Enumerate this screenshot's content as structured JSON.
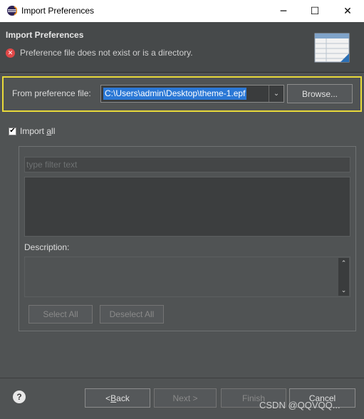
{
  "window": {
    "title": "Import Preferences",
    "minimize_icon": "─",
    "maximize_icon": "☐",
    "close_icon": "✕"
  },
  "header": {
    "title": "Import Preferences",
    "error_message": "Preference file does not exist or is a directory.",
    "error_icon": "✕"
  },
  "file_row": {
    "label": "From preference file:",
    "value": "C:\\Users\\admin\\Desktop\\theme-1.epf",
    "dropdown_icon": "⌄",
    "browse_label": "Browse..."
  },
  "import_all": {
    "checked": true,
    "check_mark": "✔",
    "label_prefix": "Import ",
    "label_mnemonic": "a",
    "label_suffix": "ll"
  },
  "group": {
    "filter_placeholder": "type filter text",
    "description_label": "Description:",
    "select_all_label": "Select All",
    "deselect_all_label": "Deselect All",
    "scroll_up": "⌃",
    "scroll_down": "⌄"
  },
  "footer": {
    "help_icon": "?",
    "back_prefix": "< ",
    "back_mnemonic": "B",
    "back_suffix": "ack",
    "next_label": "Next >",
    "finish_label": "Finish",
    "cancel_label": "Cancel"
  },
  "watermark": "CSDN @QQVQQ...",
  "colors": {
    "background": "#505354",
    "highlight_border": "#e8d93a",
    "selection": "#2b78d6",
    "error": "#e04848"
  }
}
